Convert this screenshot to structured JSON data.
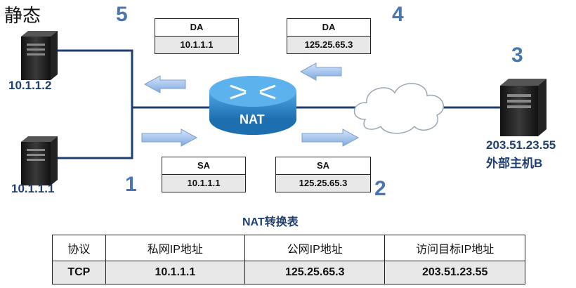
{
  "title": "静态",
  "steps": [
    "1",
    "2",
    "3",
    "4",
    "5"
  ],
  "hosts": {
    "host_top": {
      "ip": "10.1.1.2"
    },
    "host_bottom": {
      "ip": "10.1.1.1"
    },
    "host_b": {
      "ip": "203.51.23.55",
      "name": "外部主机B"
    }
  },
  "router_label": "NAT",
  "boxes": {
    "da_inside": {
      "header": "DA",
      "value": "10.1.1.1"
    },
    "da_outside": {
      "header": "DA",
      "value": "125.25.65.3"
    },
    "sa_inside": {
      "header": "SA",
      "value": "10.1.1.1"
    },
    "sa_outside": {
      "header": "SA",
      "value": "125.25.65.3"
    }
  },
  "table": {
    "title": "NAT转换表",
    "headers": [
      "协议",
      "私网IP地址",
      "公网IP地址",
      "访问目标IP地址"
    ],
    "rows": [
      [
        "TCP",
        "10.1.1.1",
        "125.25.65.3",
        "203.51.23.55"
      ]
    ]
  },
  "colors": {
    "accent": "#4a76b0",
    "link": "#1f3f73",
    "router": "#2a86c8"
  }
}
